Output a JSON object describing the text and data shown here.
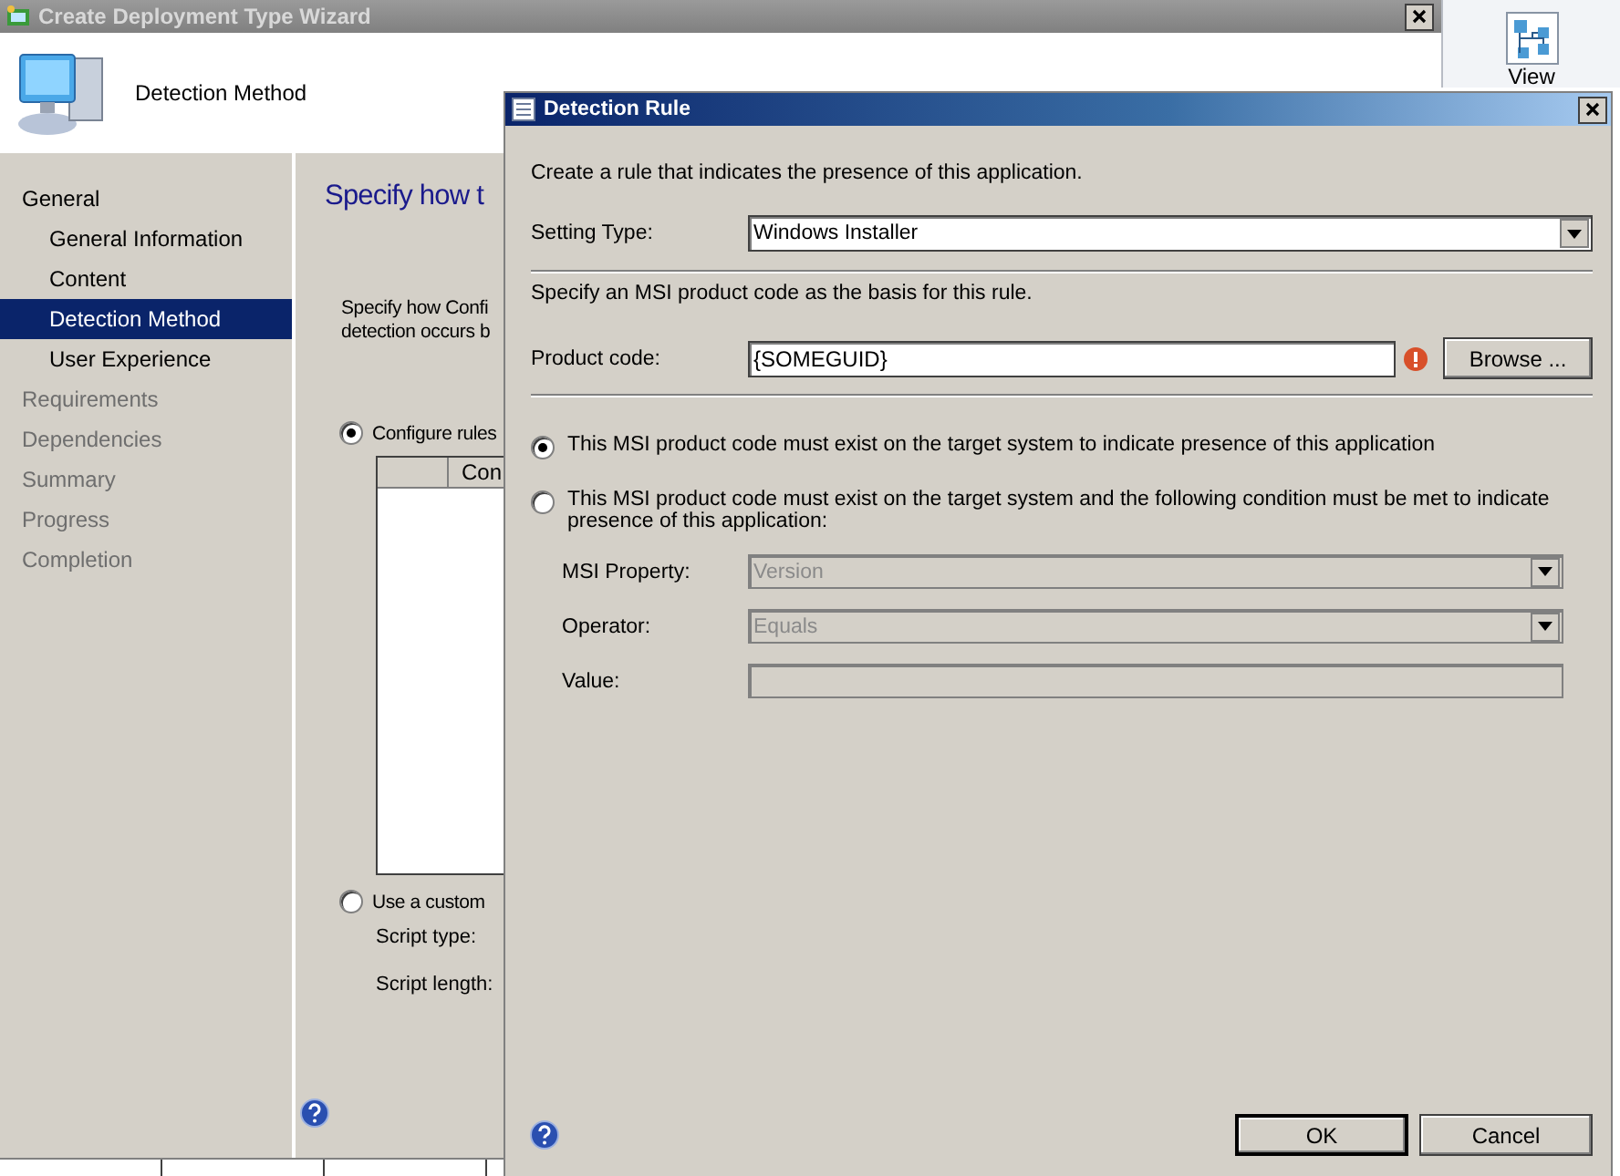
{
  "wizard": {
    "title": "Create Deployment Type Wizard",
    "page_title": "Detection Method",
    "nav": [
      {
        "label": "General",
        "selected": false,
        "disabled": false,
        "children": [
          {
            "label": "General Information",
            "selected": false,
            "disabled": false
          },
          {
            "label": "Content",
            "selected": false,
            "disabled": false
          },
          {
            "label": "Detection Method",
            "selected": true,
            "disabled": false
          },
          {
            "label": "User Experience",
            "selected": false,
            "disabled": false
          }
        ]
      },
      {
        "label": "Requirements",
        "selected": false,
        "disabled": true
      },
      {
        "label": "Dependencies",
        "selected": false,
        "disabled": true
      },
      {
        "label": "Summary",
        "selected": false,
        "disabled": true
      },
      {
        "label": "Progress",
        "selected": false,
        "disabled": true
      },
      {
        "label": "Completion",
        "selected": false,
        "disabled": true
      }
    ],
    "heading": "Specify how t",
    "description": [
      "Specify how Confi",
      "detection occurs b"
    ],
    "options": [
      {
        "label": "Configure rules",
        "selected": true
      },
      {
        "label": "Use a custom",
        "selected": false
      }
    ],
    "table_columns": [
      "Con"
    ],
    "script_fields": [
      "Script type:",
      "Script length:"
    ]
  },
  "ribbon": {
    "button": "View"
  },
  "dialog": {
    "title": "Detection Rule",
    "intro": "Create a rule that indicates the presence of this application.",
    "setting_type": {
      "label": "Setting Type:",
      "value": "Windows Installer"
    },
    "msi_intro": "Specify an MSI product code as the basis for this rule.",
    "product_code": {
      "label": "Product code:",
      "value": "{SOMEGUID}",
      "error": true
    },
    "browse": "Browse ...",
    "radios": [
      {
        "label": "This MSI product code must exist on the target system to indicate presence of this application",
        "selected": true
      },
      {
        "label": "This MSI product code must exist on the target system and the following condition must be met to indicate presence of this application:",
        "selected": false
      }
    ],
    "condition_fields": [
      {
        "kind": "dropdown",
        "label": "MSI Property:",
        "value": "Version",
        "disabled": true
      },
      {
        "kind": "dropdown",
        "label": "Operator:",
        "value": "Equals",
        "disabled": true
      },
      {
        "kind": "text",
        "label": "Value:",
        "disabled": true
      }
    ],
    "buttons": [
      {
        "label": "OK",
        "default": true
      },
      {
        "label": "Cancel",
        "default": false
      }
    ]
  }
}
